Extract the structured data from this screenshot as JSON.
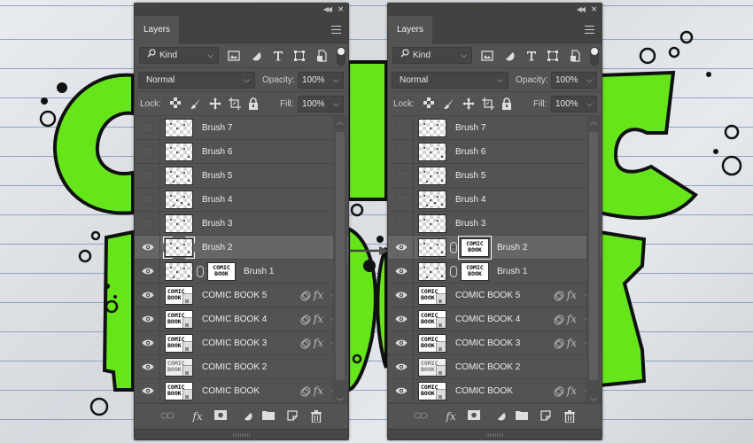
{
  "background": {
    "artwork_text": "COMIC BOOK",
    "colors": {
      "letter_fill": "#66e61a",
      "outline": "#111111",
      "paper": "#e2e5e8",
      "rule_lines": "#7d93b8"
    }
  },
  "panels": [
    {
      "id": "before",
      "tab_label": "Layers",
      "filter": {
        "label": "Kind",
        "icons": [
          "image-filter-icon",
          "adjustment-filter-icon",
          "type-filter-icon",
          "shape-filter-icon",
          "smart-object-filter-icon"
        ]
      },
      "blend_mode": "Normal",
      "opacity_label": "Opacity:",
      "opacity_value": "100%",
      "lock_label": "Lock:",
      "fill_label": "Fill:",
      "fill_value": "100%",
      "layers": [
        {
          "name": "Brush 7",
          "visible": false,
          "type": "pixel"
        },
        {
          "name": "Brush 6",
          "visible": false,
          "type": "pixel"
        },
        {
          "name": "Brush 5",
          "visible": false,
          "type": "pixel"
        },
        {
          "name": "Brush 4",
          "visible": false,
          "type": "pixel"
        },
        {
          "name": "Brush 3",
          "visible": false,
          "type": "pixel"
        },
        {
          "name": "Brush 2",
          "visible": true,
          "type": "pixel",
          "selected": true
        },
        {
          "name": "Brush 1",
          "visible": true,
          "type": "pixel-mask",
          "mask_text": "COMIC BOOK"
        },
        {
          "name": "COMIC BOOK 5",
          "visible": true,
          "type": "smart",
          "fx": true
        },
        {
          "name": "COMIC BOOK 4",
          "visible": true,
          "type": "smart",
          "fx": true
        },
        {
          "name": "COMIC BOOK 3",
          "visible": true,
          "type": "smart",
          "fx": true
        },
        {
          "name": "COMIC BOOK 2",
          "visible": true,
          "type": "smart",
          "fx": false
        },
        {
          "name": "COMIC BOOK",
          "visible": true,
          "type": "smart",
          "fx": true
        }
      ],
      "fx_label": "fx",
      "thumb_text": "COMIC BOOK"
    },
    {
      "id": "after",
      "tab_label": "Layers",
      "filter": {
        "label": "Kind",
        "icons": [
          "image-filter-icon",
          "adjustment-filter-icon",
          "type-filter-icon",
          "shape-filter-icon",
          "smart-object-filter-icon"
        ]
      },
      "blend_mode": "Normal",
      "opacity_label": "Opacity:",
      "opacity_value": "100%",
      "lock_label": "Lock:",
      "fill_label": "Fill:",
      "fill_value": "100%",
      "layers": [
        {
          "name": "Brush 7",
          "visible": false,
          "type": "pixel"
        },
        {
          "name": "Brush 6",
          "visible": false,
          "type": "pixel"
        },
        {
          "name": "Brush 5",
          "visible": false,
          "type": "pixel"
        },
        {
          "name": "Brush 4",
          "visible": false,
          "type": "pixel"
        },
        {
          "name": "Brush 3",
          "visible": false,
          "type": "pixel"
        },
        {
          "name": "Brush 2",
          "visible": true,
          "type": "pixel-mask",
          "selected": true,
          "mask_selected": true,
          "mask_text": "COMIC BOOK"
        },
        {
          "name": "Brush 1",
          "visible": true,
          "type": "pixel-mask",
          "mask_text": "COMIC BOOK"
        },
        {
          "name": "COMIC BOOK 5",
          "visible": true,
          "type": "smart",
          "fx": true
        },
        {
          "name": "COMIC BOOK 4",
          "visible": true,
          "type": "smart",
          "fx": true
        },
        {
          "name": "COMIC BOOK 3",
          "visible": true,
          "type": "smart",
          "fx": true
        },
        {
          "name": "COMIC BOOK 2",
          "visible": true,
          "type": "smart",
          "fx": false
        },
        {
          "name": "COMIC BOOK",
          "visible": true,
          "type": "smart",
          "fx": true
        }
      ],
      "fx_label": "fx",
      "thumb_text": "COMIC BOOK"
    }
  ],
  "bottom_toolbar": [
    "link-layers-icon",
    "add-layer-style-icon",
    "add-mask-icon",
    "new-adjustment-layer-icon",
    "new-group-icon",
    "new-layer-icon",
    "delete-layer-icon"
  ]
}
